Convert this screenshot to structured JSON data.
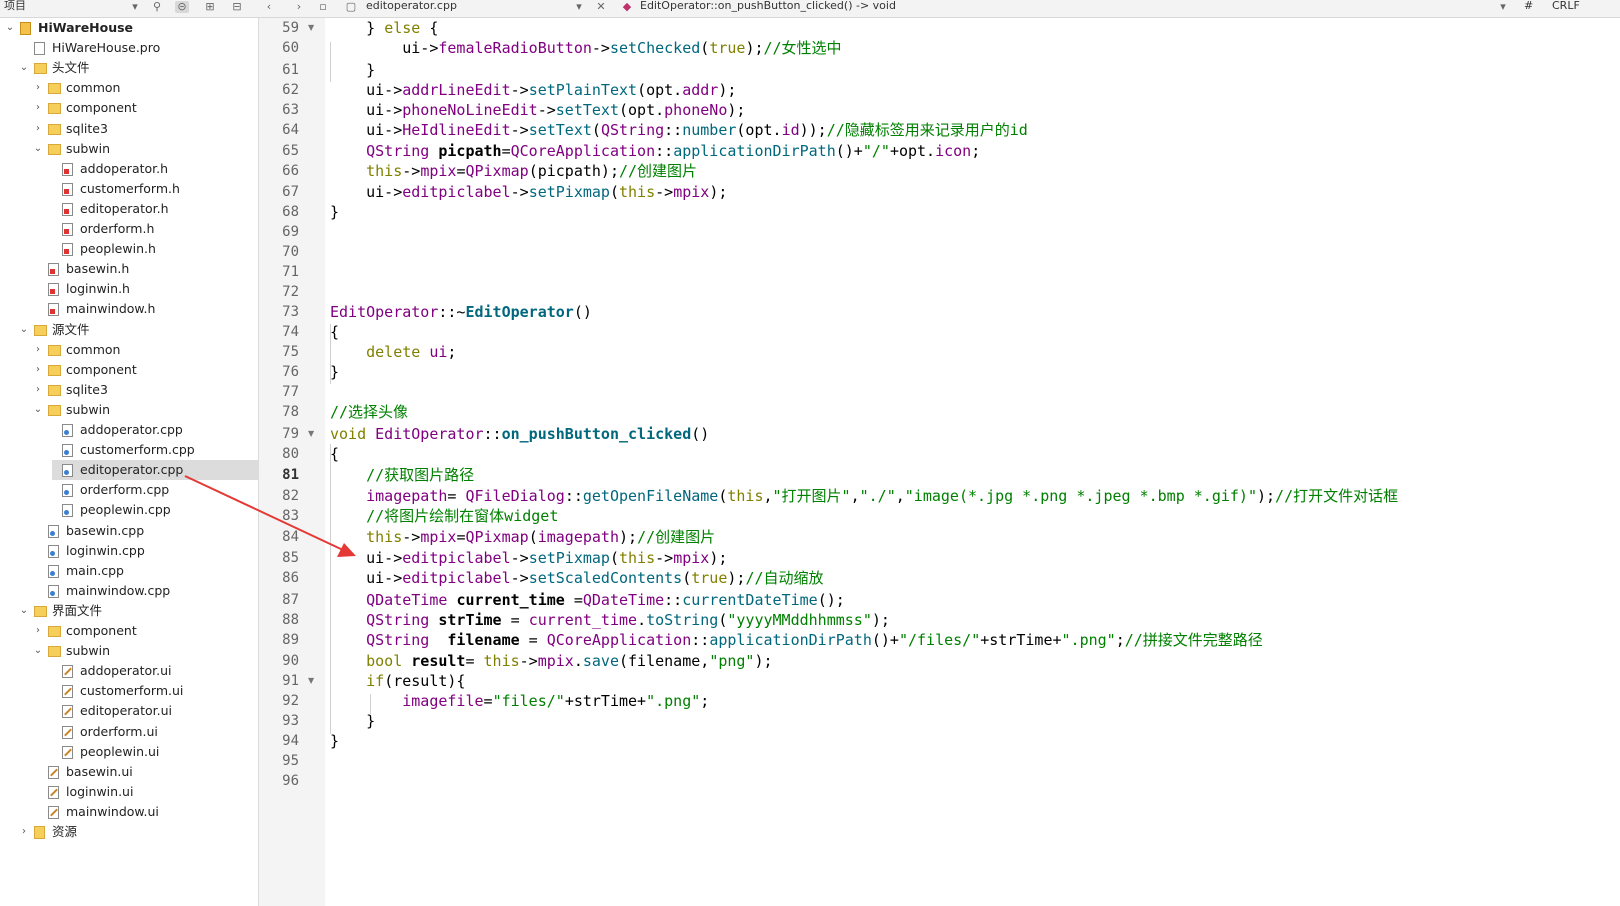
{
  "toolbar": {
    "project_label": "项目",
    "file_tab": "editoperator.cpp",
    "function_crumb": "EditOperator::on_pushButton_clicked() -> void",
    "hash": "#",
    "line_ending": "CRLF"
  },
  "colors": {
    "keyword": "#808000",
    "type": "#800080",
    "func": "#00677c",
    "string": "#008000",
    "comment": "#008000",
    "arrow": "#e53935"
  },
  "tree": [
    {
      "label": "HiWareHouse",
      "level": 0,
      "arrow": "open",
      "icon": "proj",
      "bold": true
    },
    {
      "label": "HiWareHouse.pro",
      "level": 1,
      "arrow": "",
      "icon": "pro"
    },
    {
      "label": "头文件",
      "level": 1,
      "arrow": "open",
      "icon": "folder-h"
    },
    {
      "label": "common",
      "level": 2,
      "arrow": "closed",
      "icon": "folder"
    },
    {
      "label": "component",
      "level": 2,
      "arrow": "closed",
      "icon": "folder"
    },
    {
      "label": "sqlite3",
      "level": 2,
      "arrow": "closed",
      "icon": "folder"
    },
    {
      "label": "subwin",
      "level": 2,
      "arrow": "open",
      "icon": "folder"
    },
    {
      "label": "addoperator.h",
      "level": 3,
      "arrow": "",
      "icon": "h"
    },
    {
      "label": "customerform.h",
      "level": 3,
      "arrow": "",
      "icon": "h"
    },
    {
      "label": "editoperator.h",
      "level": 3,
      "arrow": "",
      "icon": "h"
    },
    {
      "label": "orderform.h",
      "level": 3,
      "arrow": "",
      "icon": "h"
    },
    {
      "label": "peoplewin.h",
      "level": 3,
      "arrow": "",
      "icon": "h"
    },
    {
      "label": "basewin.h",
      "level": 2,
      "arrow": "",
      "icon": "h"
    },
    {
      "label": "loginwin.h",
      "level": 2,
      "arrow": "",
      "icon": "h"
    },
    {
      "label": "mainwindow.h",
      "level": 2,
      "arrow": "",
      "icon": "h"
    },
    {
      "label": "源文件",
      "level": 1,
      "arrow": "open",
      "icon": "folder-cpp"
    },
    {
      "label": "common",
      "level": 2,
      "arrow": "closed",
      "icon": "folder"
    },
    {
      "label": "component",
      "level": 2,
      "arrow": "closed",
      "icon": "folder"
    },
    {
      "label": "sqlite3",
      "level": 2,
      "arrow": "closed",
      "icon": "folder"
    },
    {
      "label": "subwin",
      "level": 2,
      "arrow": "open",
      "icon": "folder"
    },
    {
      "label": "addoperator.cpp",
      "level": 3,
      "arrow": "",
      "icon": "cpp"
    },
    {
      "label": "customerform.cpp",
      "level": 3,
      "arrow": "",
      "icon": "cpp"
    },
    {
      "label": "editoperator.cpp",
      "level": 3,
      "arrow": "",
      "icon": "cpp",
      "selected": true
    },
    {
      "label": "orderform.cpp",
      "level": 3,
      "arrow": "",
      "icon": "cpp"
    },
    {
      "label": "peoplewin.cpp",
      "level": 3,
      "arrow": "",
      "icon": "cpp"
    },
    {
      "label": "basewin.cpp",
      "level": 2,
      "arrow": "",
      "icon": "cpp"
    },
    {
      "label": "loginwin.cpp",
      "level": 2,
      "arrow": "",
      "icon": "cpp"
    },
    {
      "label": "main.cpp",
      "level": 2,
      "arrow": "",
      "icon": "cpp"
    },
    {
      "label": "mainwindow.cpp",
      "level": 2,
      "arrow": "",
      "icon": "cpp"
    },
    {
      "label": "界面文件",
      "level": 1,
      "arrow": "open",
      "icon": "folder-ui"
    },
    {
      "label": "component",
      "level": 2,
      "arrow": "closed",
      "icon": "folder"
    },
    {
      "label": "subwin",
      "level": 2,
      "arrow": "open",
      "icon": "folder"
    },
    {
      "label": "addoperator.ui",
      "level": 3,
      "arrow": "",
      "icon": "ui"
    },
    {
      "label": "customerform.ui",
      "level": 3,
      "arrow": "",
      "icon": "ui"
    },
    {
      "label": "editoperator.ui",
      "level": 3,
      "arrow": "",
      "icon": "ui"
    },
    {
      "label": "orderform.ui",
      "level": 3,
      "arrow": "",
      "icon": "ui"
    },
    {
      "label": "peoplewin.ui",
      "level": 3,
      "arrow": "",
      "icon": "ui"
    },
    {
      "label": "basewin.ui",
      "level": 2,
      "arrow": "",
      "icon": "ui"
    },
    {
      "label": "loginwin.ui",
      "level": 2,
      "arrow": "",
      "icon": "ui"
    },
    {
      "label": "mainwindow.ui",
      "level": 2,
      "arrow": "",
      "icon": "ui"
    },
    {
      "label": "资源",
      "level": 1,
      "arrow": "closed",
      "icon": "res"
    }
  ],
  "editor": {
    "current_line": 81,
    "fold_lines": [
      59,
      79,
      91
    ],
    "lines": [
      {
        "n": 59,
        "t": [
          [
            "    } ",
            ""
          ],
          [
            "else",
            "kw"
          ],
          [
            " {",
            ""
          ]
        ]
      },
      {
        "n": 60,
        "t": [
          [
            "        ui->",
            ""
          ],
          [
            "femaleRadioButton",
            "mem"
          ],
          [
            "->",
            ""
          ],
          [
            "setChecked",
            "fn"
          ],
          [
            "(",
            ""
          ],
          [
            "true",
            "kw"
          ],
          [
            ");",
            ""
          ],
          [
            "//女性选中",
            "cm"
          ]
        ]
      },
      {
        "n": 61,
        "t": [
          [
            "    }",
            ""
          ]
        ]
      },
      {
        "n": 62,
        "t": [
          [
            "    ui->",
            ""
          ],
          [
            "addrLineEdit",
            "mem"
          ],
          [
            "->",
            ""
          ],
          [
            "setPlainText",
            "fn"
          ],
          [
            "(opt.",
            ""
          ],
          [
            "addr",
            "mem"
          ],
          [
            ");",
            ""
          ]
        ]
      },
      {
        "n": 63,
        "t": [
          [
            "    ui->",
            ""
          ],
          [
            "phoneNoLineEdit",
            "mem"
          ],
          [
            "->",
            ""
          ],
          [
            "setText",
            "fn"
          ],
          [
            "(opt.",
            ""
          ],
          [
            "phoneNo",
            "mem"
          ],
          [
            ");",
            ""
          ]
        ]
      },
      {
        "n": 64,
        "t": [
          [
            "    ui->",
            ""
          ],
          [
            "HeIdlineEdit",
            "mem"
          ],
          [
            "->",
            ""
          ],
          [
            "setText",
            "fn"
          ],
          [
            "(",
            ""
          ],
          [
            "QString",
            "ty"
          ],
          [
            "::",
            ""
          ],
          [
            "number",
            "fn"
          ],
          [
            "(opt.",
            ""
          ],
          [
            "id",
            "mem"
          ],
          [
            "));",
            ""
          ],
          [
            "//隐藏标签用来记录用户的id",
            "cm"
          ]
        ]
      },
      {
        "n": 65,
        "t": [
          [
            "    ",
            ""
          ],
          [
            "QString",
            "ty"
          ],
          [
            " ",
            ""
          ],
          [
            "picpath",
            "bold"
          ],
          [
            "=",
            ""
          ],
          [
            "QCoreApplication",
            "ty"
          ],
          [
            "::",
            ""
          ],
          [
            "applicationDirPath",
            "fn"
          ],
          [
            "()+",
            ""
          ],
          [
            "\"/\"",
            "str"
          ],
          [
            "+opt.",
            ""
          ],
          [
            "icon",
            "mem"
          ],
          [
            ";",
            ""
          ]
        ]
      },
      {
        "n": 66,
        "t": [
          [
            "    ",
            ""
          ],
          [
            "this",
            "kw"
          ],
          [
            "->",
            ""
          ],
          [
            "mpix",
            "mem"
          ],
          [
            "=",
            ""
          ],
          [
            "QPixmap",
            "ty"
          ],
          [
            "(picpath);",
            ""
          ],
          [
            "//创建图片",
            "cm"
          ]
        ]
      },
      {
        "n": 67,
        "t": [
          [
            "    ui->",
            ""
          ],
          [
            "editpiclabel",
            "mem"
          ],
          [
            "->",
            ""
          ],
          [
            "setPixmap",
            "fn"
          ],
          [
            "(",
            ""
          ],
          [
            "this",
            "kw"
          ],
          [
            "->",
            ""
          ],
          [
            "mpix",
            "mem"
          ],
          [
            ");",
            ""
          ]
        ]
      },
      {
        "n": 68,
        "t": [
          [
            "}",
            ""
          ]
        ]
      },
      {
        "n": 69,
        "t": []
      },
      {
        "n": 70,
        "t": []
      },
      {
        "n": 71,
        "t": []
      },
      {
        "n": 72,
        "t": []
      },
      {
        "n": 73,
        "t": [
          [
            "EditOperator",
            "ty"
          ],
          [
            "::~",
            ""
          ],
          [
            "EditOperator",
            "fnb"
          ],
          [
            "()",
            ""
          ]
        ]
      },
      {
        "n": 74,
        "t": [
          [
            "{",
            ""
          ]
        ]
      },
      {
        "n": 75,
        "t": [
          [
            "    ",
            ""
          ],
          [
            "delete",
            "kw"
          ],
          [
            " ",
            ""
          ],
          [
            "ui",
            "mem"
          ],
          [
            ";",
            ""
          ]
        ]
      },
      {
        "n": 76,
        "t": [
          [
            "}",
            ""
          ]
        ]
      },
      {
        "n": 77,
        "t": []
      },
      {
        "n": 78,
        "t": [
          [
            "//选择头像",
            "cm"
          ]
        ]
      },
      {
        "n": 79,
        "t": [
          [
            "void",
            "kw"
          ],
          [
            " ",
            ""
          ],
          [
            "EditOperator",
            "ty"
          ],
          [
            "::",
            ""
          ],
          [
            "on_pushButton_clicked",
            "fnb"
          ],
          [
            "()",
            ""
          ]
        ]
      },
      {
        "n": 80,
        "t": [
          [
            "{",
            ""
          ]
        ]
      },
      {
        "n": 81,
        "t": [
          [
            "    ",
            ""
          ],
          [
            "//获取图片路径",
            "cm"
          ]
        ]
      },
      {
        "n": 82,
        "t": [
          [
            "    ",
            ""
          ],
          [
            "imagepath",
            "mem"
          ],
          [
            "= ",
            ""
          ],
          [
            "QFileDialog",
            "ty"
          ],
          [
            "::",
            ""
          ],
          [
            "getOpenFileName",
            "fn"
          ],
          [
            "(",
            ""
          ],
          [
            "this",
            "kw"
          ],
          [
            ",",
            ""
          ],
          [
            "\"打开图片\"",
            "str"
          ],
          [
            ",",
            ""
          ],
          [
            "\"./\"",
            "str"
          ],
          [
            ",",
            ""
          ],
          [
            "\"image(*.jpg *.png *.jpeg *.bmp *.gif)\"",
            "str"
          ],
          [
            ");",
            ""
          ],
          [
            "//打开文件对话框",
            "cm"
          ]
        ]
      },
      {
        "n": 83,
        "t": [
          [
            "    ",
            ""
          ],
          [
            "//将图片绘制在窗体widget",
            "cm"
          ]
        ]
      },
      {
        "n": 84,
        "t": [
          [
            "    ",
            ""
          ],
          [
            "this",
            "kw"
          ],
          [
            "->",
            ""
          ],
          [
            "mpix",
            "mem"
          ],
          [
            "=",
            ""
          ],
          [
            "QPixmap",
            "ty"
          ],
          [
            "(",
            ""
          ],
          [
            "imagepath",
            "mem"
          ],
          [
            ");",
            ""
          ],
          [
            "//创建图片",
            "cm"
          ]
        ]
      },
      {
        "n": 85,
        "t": [
          [
            "    ui->",
            ""
          ],
          [
            "editpiclabel",
            "mem"
          ],
          [
            "->",
            ""
          ],
          [
            "setPixmap",
            "fn"
          ],
          [
            "(",
            ""
          ],
          [
            "this",
            "kw"
          ],
          [
            "->",
            ""
          ],
          [
            "mpix",
            "mem"
          ],
          [
            ");",
            ""
          ]
        ]
      },
      {
        "n": 86,
        "t": [
          [
            "    ui->",
            ""
          ],
          [
            "editpiclabel",
            "mem"
          ],
          [
            "->",
            ""
          ],
          [
            "setScaledContents",
            "fn"
          ],
          [
            "(",
            ""
          ],
          [
            "true",
            "kw"
          ],
          [
            ");",
            ""
          ],
          [
            "//自动缩放",
            "cm"
          ]
        ]
      },
      {
        "n": 87,
        "t": [
          [
            "    ",
            ""
          ],
          [
            "QDateTime",
            "ty"
          ],
          [
            " ",
            ""
          ],
          [
            "current_time",
            "bold"
          ],
          [
            " =",
            ""
          ],
          [
            "QDateTime",
            "ty"
          ],
          [
            "::",
            ""
          ],
          [
            "currentDateTime",
            "fn"
          ],
          [
            "();",
            ""
          ]
        ]
      },
      {
        "n": 88,
        "t": [
          [
            "    ",
            ""
          ],
          [
            "QString",
            "ty"
          ],
          [
            " ",
            ""
          ],
          [
            "strTime",
            "bold"
          ],
          [
            " = ",
            ""
          ],
          [
            "current_time",
            "mem"
          ],
          [
            ".",
            ""
          ],
          [
            "toString",
            "fn"
          ],
          [
            "(",
            ""
          ],
          [
            "\"yyyyMMddhhmmss\"",
            "str"
          ],
          [
            ");",
            ""
          ]
        ]
      },
      {
        "n": 89,
        "t": [
          [
            "    ",
            ""
          ],
          [
            "QString",
            "ty"
          ],
          [
            "  ",
            ""
          ],
          [
            "filename",
            "bold"
          ],
          [
            " = ",
            ""
          ],
          [
            "QCoreApplication",
            "ty"
          ],
          [
            "::",
            ""
          ],
          [
            "applicationDirPath",
            "fn"
          ],
          [
            "()+",
            ""
          ],
          [
            "\"/files/\"",
            "str"
          ],
          [
            "+strTime+",
            ""
          ],
          [
            "\".png\"",
            "str"
          ],
          [
            ";",
            ""
          ],
          [
            "//拼接文件完整路径",
            "cm"
          ]
        ]
      },
      {
        "n": 90,
        "t": [
          [
            "    ",
            ""
          ],
          [
            "bool",
            "kw"
          ],
          [
            " ",
            ""
          ],
          [
            "result",
            "bold"
          ],
          [
            "= ",
            ""
          ],
          [
            "this",
            "kw"
          ],
          [
            "->",
            ""
          ],
          [
            "mpix",
            "mem"
          ],
          [
            ".",
            ""
          ],
          [
            "save",
            "fn"
          ],
          [
            "(filename,",
            ""
          ],
          [
            "\"png\"",
            "str"
          ],
          [
            ");",
            ""
          ]
        ]
      },
      {
        "n": 91,
        "t": [
          [
            "    ",
            ""
          ],
          [
            "if",
            "kw"
          ],
          [
            "(result){",
            ""
          ]
        ]
      },
      {
        "n": 92,
        "t": [
          [
            "        ",
            ""
          ],
          [
            "imagefile",
            "mem"
          ],
          [
            "=",
            ""
          ],
          [
            "\"files/\"",
            "str"
          ],
          [
            "+strTime+",
            ""
          ],
          [
            "\".png\"",
            "str"
          ],
          [
            ";",
            ""
          ]
        ]
      },
      {
        "n": 93,
        "t": [
          [
            "    }",
            ""
          ]
        ]
      },
      {
        "n": 94,
        "t": [
          [
            "}",
            ""
          ]
        ]
      },
      {
        "n": 95,
        "t": []
      },
      {
        "n": 96,
        "t": []
      }
    ]
  }
}
